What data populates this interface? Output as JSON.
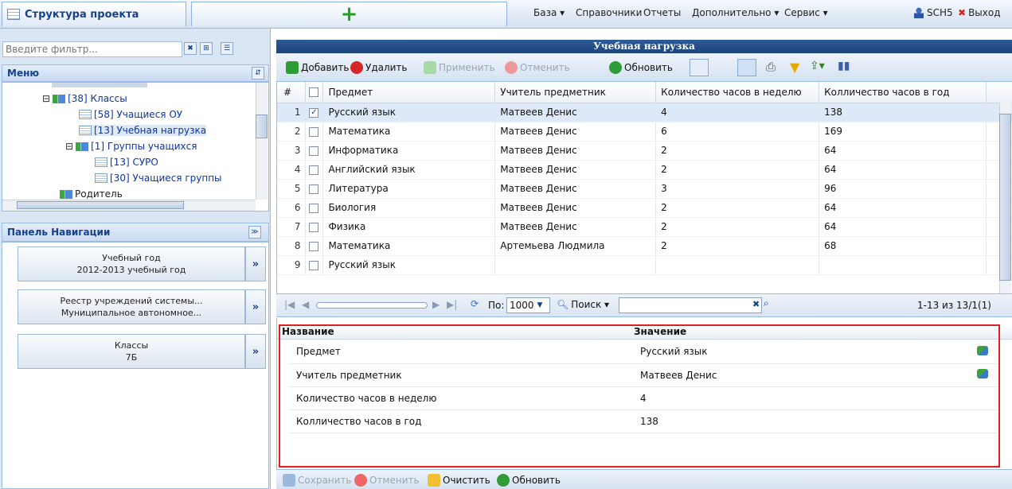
{
  "tabs": {
    "structure": "Структура проекта"
  },
  "menu": {
    "items": [
      "База ▾",
      "Справочники",
      "Отчеты",
      "Дополнительно ▾",
      "Сервис ▾"
    ],
    "user": "SCH5",
    "exit": "Выход"
  },
  "filter": {
    "placeholder": "Введите фильтр..."
  },
  "menu_panel": {
    "title": "Меню"
  },
  "tree": [
    {
      "label": "[38] Классы",
      "type": "folder"
    },
    {
      "label": "[58] Учащиеся ОУ",
      "type": "table"
    },
    {
      "label": "[13] Учебная нагрузка",
      "type": "table"
    },
    {
      "label": "[1] Группы учащихся",
      "type": "folder"
    },
    {
      "label": "[13] СУРО",
      "type": "table"
    },
    {
      "label": "[30] Учащиеся группы",
      "type": "table"
    },
    {
      "label": "Родитель",
      "type": "folder"
    }
  ],
  "nav_panel": {
    "title": "Панель Навигации",
    "buttons": [
      {
        "line1": "Учебный год",
        "line2": "2012-2013 учебный год"
      },
      {
        "line1": "Реестр учреждений системы...",
        "line2": "Муниципальное автономное..."
      },
      {
        "line1": "Классы",
        "line2": "7Б"
      }
    ]
  },
  "main": {
    "title": "Учебная нагрузка"
  },
  "toolbar": {
    "add": "Добавить",
    "delete": "Удалить",
    "apply": "Применить",
    "cancel": "Отменить",
    "refresh": "Обновить"
  },
  "grid": {
    "headers": [
      "#",
      "",
      "Предмет",
      "Учитель предметник",
      "Количество часов в неделю",
      "Колличество часов в год"
    ],
    "rows": [
      {
        "n": "1",
        "checked": true,
        "subject": "Русский язык",
        "teacher": "Матвеев Денис",
        "week": "4",
        "year": "138"
      },
      {
        "n": "2",
        "checked": false,
        "subject": "Математика",
        "teacher": "Матвеев Денис",
        "week": "6",
        "year": "169"
      },
      {
        "n": "3",
        "checked": false,
        "subject": "Информатика",
        "teacher": "Матвеев Денис",
        "week": "2",
        "year": "64"
      },
      {
        "n": "4",
        "checked": false,
        "subject": "Английский язык",
        "teacher": "Матвеев Денис",
        "week": "2",
        "year": "64"
      },
      {
        "n": "5",
        "checked": false,
        "subject": "Литература",
        "teacher": "Матвеев Денис",
        "week": "3",
        "year": "96"
      },
      {
        "n": "6",
        "checked": false,
        "subject": "Биология",
        "teacher": "Матвеев Денис",
        "week": "2",
        "year": "64"
      },
      {
        "n": "7",
        "checked": false,
        "subject": "Физика",
        "teacher": "Матвеев Денис",
        "week": "2",
        "year": "64"
      },
      {
        "n": "8",
        "checked": false,
        "subject": "Математика",
        "teacher": "Артемьева Людмила",
        "week": "2",
        "year": "68"
      },
      {
        "n": "9",
        "checked": false,
        "subject": "Русский язык",
        "teacher": "",
        "week": "",
        "year": ""
      }
    ]
  },
  "pager": {
    "per_page_label": "По:",
    "per_page": "1000",
    "search": "Поиск ▾",
    "summary": "1-13 из 13/1(1)"
  },
  "props": {
    "header_name": "Название",
    "header_value": "Значение",
    "rows": [
      {
        "name": "Предмет",
        "value": "Русский язык"
      },
      {
        "name": "Учитель предметник",
        "value": "Матвеев Денис"
      },
      {
        "name": "Количество часов в неделю",
        "value": "4"
      },
      {
        "name": "Колличество часов в год",
        "value": "138"
      }
    ]
  },
  "bottom": {
    "save": "Сохранить",
    "cancel": "Отменить",
    "clear": "Очистить",
    "refresh": "Обновить"
  },
  "colors": {
    "accent": "#15428b",
    "highlight": "#e02020",
    "header_dark": "#1d4478"
  }
}
